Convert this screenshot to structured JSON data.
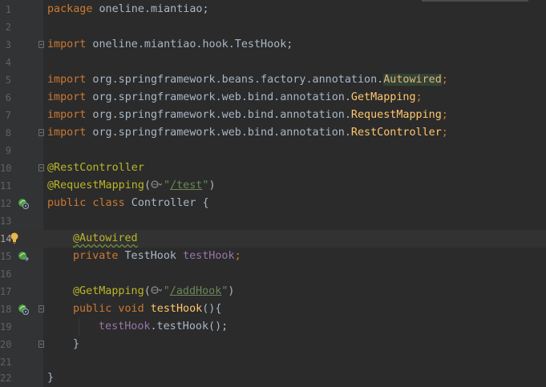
{
  "editor": {
    "current_line": 14,
    "lines": [
      {
        "n": "1"
      },
      {
        "n": "2"
      },
      {
        "n": "3"
      },
      {
        "n": "4"
      },
      {
        "n": "5"
      },
      {
        "n": "6"
      },
      {
        "n": "7"
      },
      {
        "n": "8"
      },
      {
        "n": "9"
      },
      {
        "n": "10"
      },
      {
        "n": "11"
      },
      {
        "n": "12"
      },
      {
        "n": "13"
      },
      {
        "n": "14"
      },
      {
        "n": "15"
      },
      {
        "n": "16"
      },
      {
        "n": "17"
      },
      {
        "n": "18"
      },
      {
        "n": "19"
      },
      {
        "n": "20"
      },
      {
        "n": "21"
      },
      {
        "n": "22"
      }
    ],
    "tokens": {
      "l1_kw": "package",
      "l1_rest": " oneline.miantiao;",
      "l3_kw": "import",
      "l3_rest": " oneline.miantiao.hook.TestHook;",
      "l5_kw": "import",
      "l5_path": " org.springframework.beans.factory.annotation.",
      "l5_cls": "Autowired",
      "l5_semi": ";",
      "l6_kw": "import",
      "l6_path": " org.springframework.web.bind.annotation.",
      "l6_cls": "GetMapping",
      "l6_semi": ";",
      "l7_kw": "import",
      "l7_path": " org.springframework.web.bind.annotation.",
      "l7_cls": "RequestMapping",
      "l7_semi": ";",
      "l8_kw": "import",
      "l8_path": " org.springframework.web.bind.annotation.",
      "l8_cls": "RestController",
      "l8_semi": ";",
      "l10_ann": "@RestController",
      "l11_ann": "@RequestMapping",
      "l11_open": "(",
      "l11_q1": "\"",
      "l11_url": "/test",
      "l11_q2": "\"",
      "l11_close": ")",
      "l12_kw": "public class",
      "l12_name": " Controller ",
      "l12_brace": "{",
      "l14_ann": "@Autowired",
      "l15_kw": "private",
      "l15_type": " TestHook ",
      "l15_fld": "testHook",
      "l15_semi": ";",
      "l17_ann": "@GetMapping",
      "l17_open": "(",
      "l17_q1": "\"",
      "l17_url": "/addHook",
      "l17_q2": "\"",
      "l17_close": ")",
      "l18_kw": "public void",
      "l18_fn": " testHook",
      "l18_rest": "(){",
      "l19_fld": "testHook",
      "l19_rest": ".testHook();",
      "l20_brace": "}",
      "l22_brace": "}"
    },
    "gutter_icons": {
      "bean_icon_color": "#4e9a3c",
      "bulb_icon_color": "#e8b64a"
    }
  }
}
